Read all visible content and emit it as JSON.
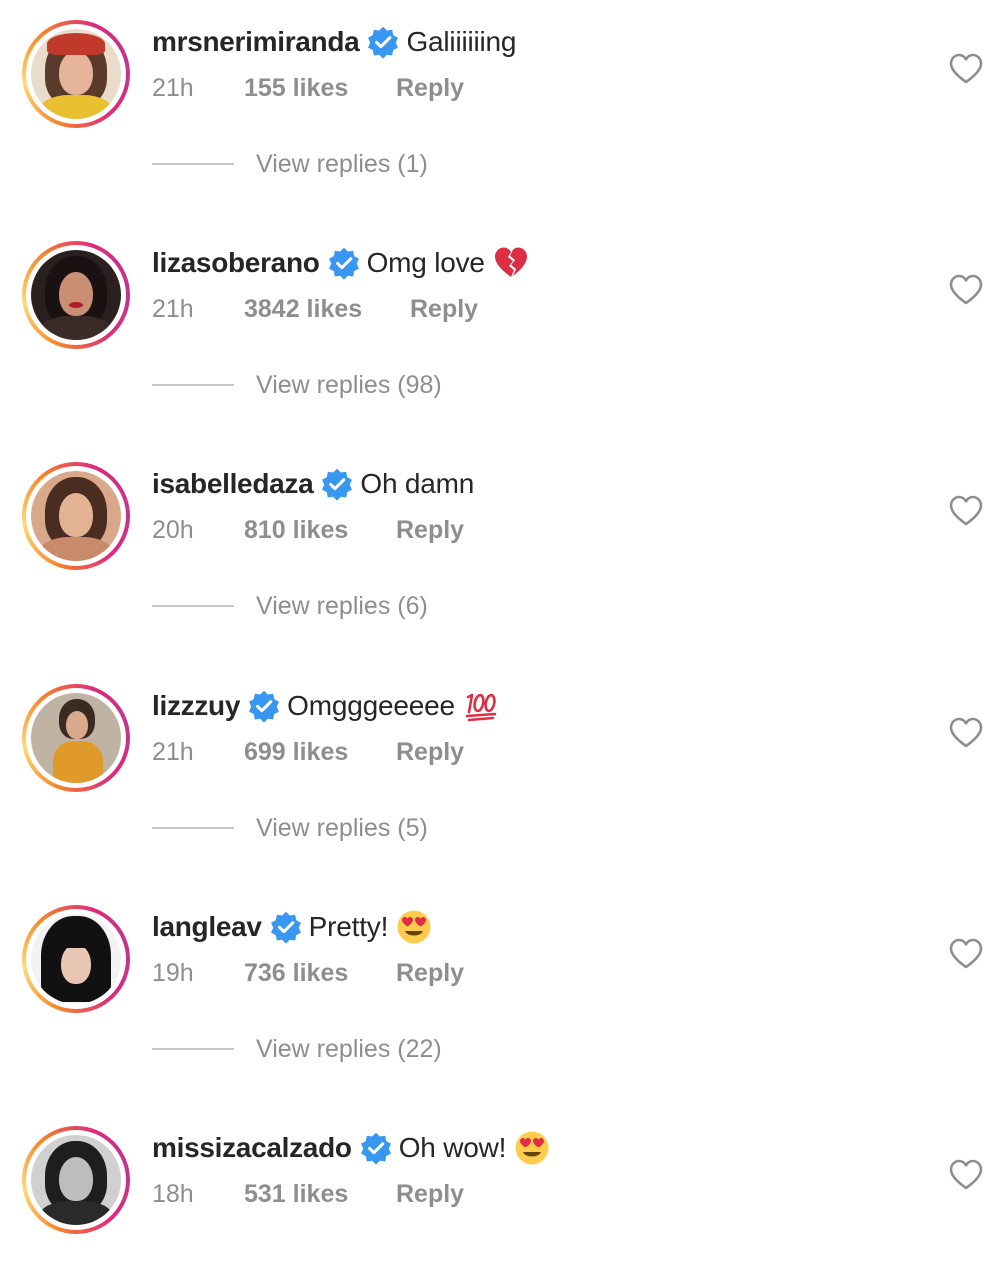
{
  "comments": [
    {
      "username": "mrsnerimiranda",
      "text": "Galiiiiiing",
      "emoji": "",
      "time": "21h",
      "likes": "155 likes",
      "reply": "Reply",
      "view_replies": "View replies (1)",
      "avatar_icon": "avatar-photo"
    },
    {
      "username": "lizasoberano",
      "text": "Omg love",
      "emoji": "broken-heart-emoji",
      "time": "21h",
      "likes": "3842 likes",
      "reply": "Reply",
      "view_replies": "View replies (98)",
      "avatar_icon": "avatar-photo"
    },
    {
      "username": "isabelledaza",
      "text": "Oh damn",
      "emoji": "",
      "time": "20h",
      "likes": "810 likes",
      "reply": "Reply",
      "view_replies": "View replies (6)",
      "avatar_icon": "avatar-photo"
    },
    {
      "username": "lizzzuy",
      "text": "Omgggeeeee",
      "emoji": "hundred-points-emoji",
      "time": "21h",
      "likes": "699 likes",
      "reply": "Reply",
      "view_replies": "View replies (5)",
      "avatar_icon": "avatar-photo"
    },
    {
      "username": "langleav",
      "text": "Pretty!",
      "emoji": "heart-eyes-emoji",
      "time": "19h",
      "likes": "736 likes",
      "reply": "Reply",
      "view_replies": "View replies (22)",
      "avatar_icon": "avatar-photo"
    },
    {
      "username": "missizacalzado",
      "text": "Oh wow!",
      "emoji": "heart-eyes-emoji",
      "time": "18h",
      "likes": "531 likes",
      "reply": "Reply",
      "view_replies": "",
      "avatar_icon": "avatar-photo"
    }
  ],
  "colors": {
    "verified_badge": "#3897f0",
    "secondary_text": "#8e8e8e",
    "primary_text": "#262626",
    "story_ring_start": "#f58529",
    "story_ring_end": "#dd2a7b"
  },
  "icons": {
    "verified": "verified-badge-icon",
    "like": "heart-outline-icon"
  }
}
